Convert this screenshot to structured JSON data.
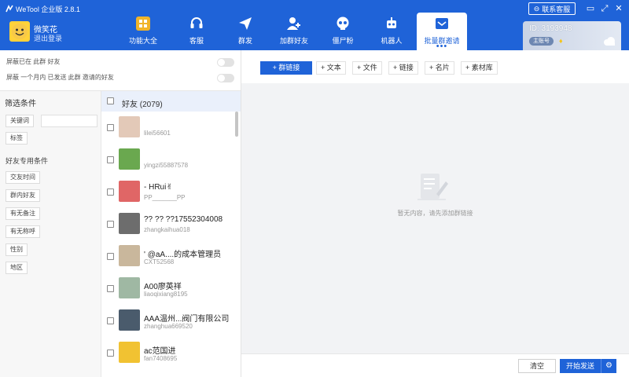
{
  "app": {
    "title": "WeTool 企业版 2.8.1",
    "support_label": "联系客服"
  },
  "window_controls": {
    "minimize": "▭",
    "maximize": "⤢",
    "close": "✕"
  },
  "user": {
    "name": "微笑花",
    "logout": "退出登录"
  },
  "nav": {
    "items": [
      {
        "label": "功能大全",
        "icon": "grid-icon"
      },
      {
        "label": "客服",
        "icon": "headset-icon"
      },
      {
        "label": "群发",
        "icon": "send-icon"
      },
      {
        "label": "加群好友",
        "icon": "add-user-icon"
      },
      {
        "label": "僵尸粉",
        "icon": "skull-icon"
      },
      {
        "label": "机器人",
        "icon": "robot-icon"
      },
      {
        "label": "批量群邀请",
        "icon": "invite-icon"
      }
    ],
    "active_index": 6,
    "more": "•••"
  },
  "account": {
    "id_text": "ID: 3193948",
    "badge": "主账号",
    "diamond": "♦"
  },
  "options": {
    "opt1": "屏蔽已在 此群 好友",
    "opt2": "屏蔽 一个月内 已发送 此群 邀请的好友",
    "opt1_on": false,
    "opt2_on": false
  },
  "filter": {
    "title": "筛选条件",
    "keyword": "关键词",
    "tag": "标签",
    "friend_conditions": "好友专用条件",
    "chips": [
      "交友时间",
      "群内好友",
      "有无备注",
      "有无称呼",
      "性别",
      "地区"
    ]
  },
  "friends": {
    "header": "好友 (2079)",
    "list": [
      {
        "name": "",
        "id": "lilei56601",
        "avatar": "#e3c9b8"
      },
      {
        "name": "",
        "id": "yingzi55887578",
        "avatar": "#6aa84f"
      },
      {
        "name": "- HRui✌",
        "id": "PP_______PP",
        "avatar": "#e06666"
      },
      {
        "name": "?? ?? ??17552304008",
        "id": "zhangkaihua018",
        "avatar": "#6d6d6d"
      },
      {
        "name": "' @aA....的成本管理员",
        "id": "CXT52568",
        "avatar": "#c9b79c"
      },
      {
        "name": "A00廖英祥",
        "id": "liaoqixiang8195",
        "avatar": "#9fb8a3"
      },
      {
        "name": "AAA温州...阀门有限公司",
        "id": "zhanghua669520",
        "avatar": "#4a5b6c"
      },
      {
        "name": "ac范国进",
        "id": "fan7408695",
        "avatar": "#f1c232"
      }
    ]
  },
  "toolbar": {
    "primary": "+ 群链接",
    "buttons": [
      "+ 文本",
      "+ 文件",
      "+ 链接",
      "+ 名片",
      "+ 素材库"
    ]
  },
  "empty": {
    "text": "暂无内容，请先添加群链接"
  },
  "actions": {
    "clear": "清空",
    "start": "开始发送"
  },
  "colors": {
    "primary": "#1f63d8",
    "panel_bg": "#f2f3f5"
  }
}
